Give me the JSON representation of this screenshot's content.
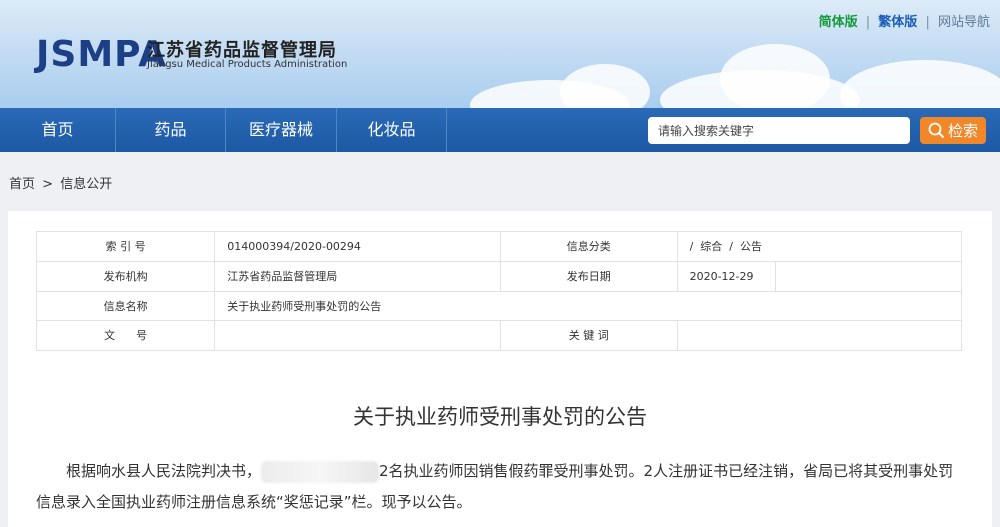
{
  "header": {
    "logo": "JSMPA",
    "org_name_cn": "江苏省药品监督管理局",
    "org_name_en": "Jiangsu Medical Products Administration",
    "links": {
      "simplified": "简体版",
      "traditional": "繁体版",
      "site_nav": "网站导航",
      "separator": "|"
    }
  },
  "nav": {
    "items": [
      "首页",
      "药品",
      "医疗器械",
      "化妆品"
    ],
    "search_placeholder": "请输入搜索关键字",
    "search_button": "检索"
  },
  "breadcrumb": {
    "home": "首页",
    "separator": ">",
    "current": "信息公开"
  },
  "info_table": {
    "index_label": "索 引 号",
    "index_value": "014000394/2020-00294",
    "category_label": "信息分类",
    "category_value": "/  综合  /  公告",
    "publisher_label": "发布机构",
    "publisher_value": "江苏省药品监督管理局",
    "date_label": "发布日期",
    "date_value": "2020-12-29",
    "name_label": "信息名称",
    "name_value": "关于执业药师受刑事处罚的公告",
    "doc_label": "文      号",
    "doc_value": "",
    "keyword_label": "关 键 词",
    "keyword_value": ""
  },
  "article": {
    "title": "关于执业药师受刑事处罚的公告",
    "body_part1": "根据响水县人民法院判决书，",
    "body_part2": "2名执业药师因销售假药罪受刑事处罚。2人注册证书已经注销，省局已将其受刑事处罚信息录入全国执业药师注册信息系统“奖惩记录”栏。现予以公告。"
  },
  "colors": {
    "nav_bg": "#1d59a4",
    "search_button": "#f0882a",
    "logo": "#1c3f86",
    "link_simplified": "#139a3b",
    "link_traditional": "#1d5fb8"
  }
}
